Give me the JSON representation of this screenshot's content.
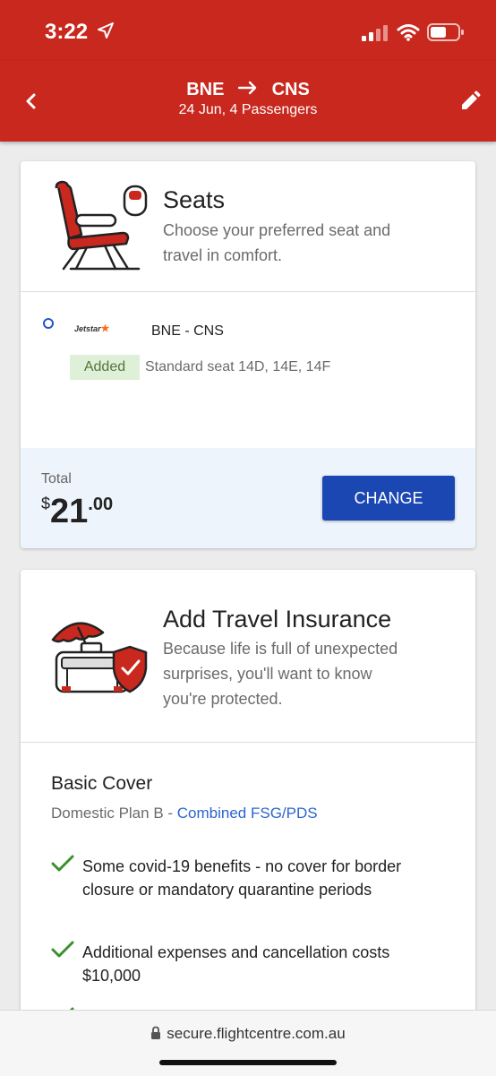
{
  "status": {
    "time": "3:22"
  },
  "header": {
    "origin": "BNE",
    "destination": "CNS",
    "subtitle": "24 Jun, 4 Passengers"
  },
  "seats": {
    "title": "Seats",
    "description_line1": "Choose your preferred seat and",
    "description_line2": "travel in comfort.",
    "airline": "Jetstar",
    "route": "BNE - CNS",
    "badge": "Added",
    "seat_info": "Standard seat 14D, 14E, 14F",
    "total_label": "Total",
    "currency": "$",
    "amount_main": "21",
    "amount_cents": ".00",
    "change_label": "CHANGE"
  },
  "insurance": {
    "title": "Add Travel Insurance",
    "description_line1": "Because life is full of unexpected",
    "description_line2": "surprises, you'll want to know",
    "description_line3": "you're protected.",
    "cover_title": "Basic Cover",
    "plan_text": "Domestic Plan B - ",
    "plan_link": "Combined FSG/PDS",
    "benefits": [
      "Some covid-19 benefits - no cover for border closure or mandatory quarantine periods",
      "Additional expenses and cancellation costs $10,000"
    ]
  },
  "browser": {
    "url": "secure.flightcentre.com.au"
  },
  "colors": {
    "brand_red": "#c8281e",
    "button_blue": "#1b47b3",
    "check_green": "#3a8f2c"
  }
}
